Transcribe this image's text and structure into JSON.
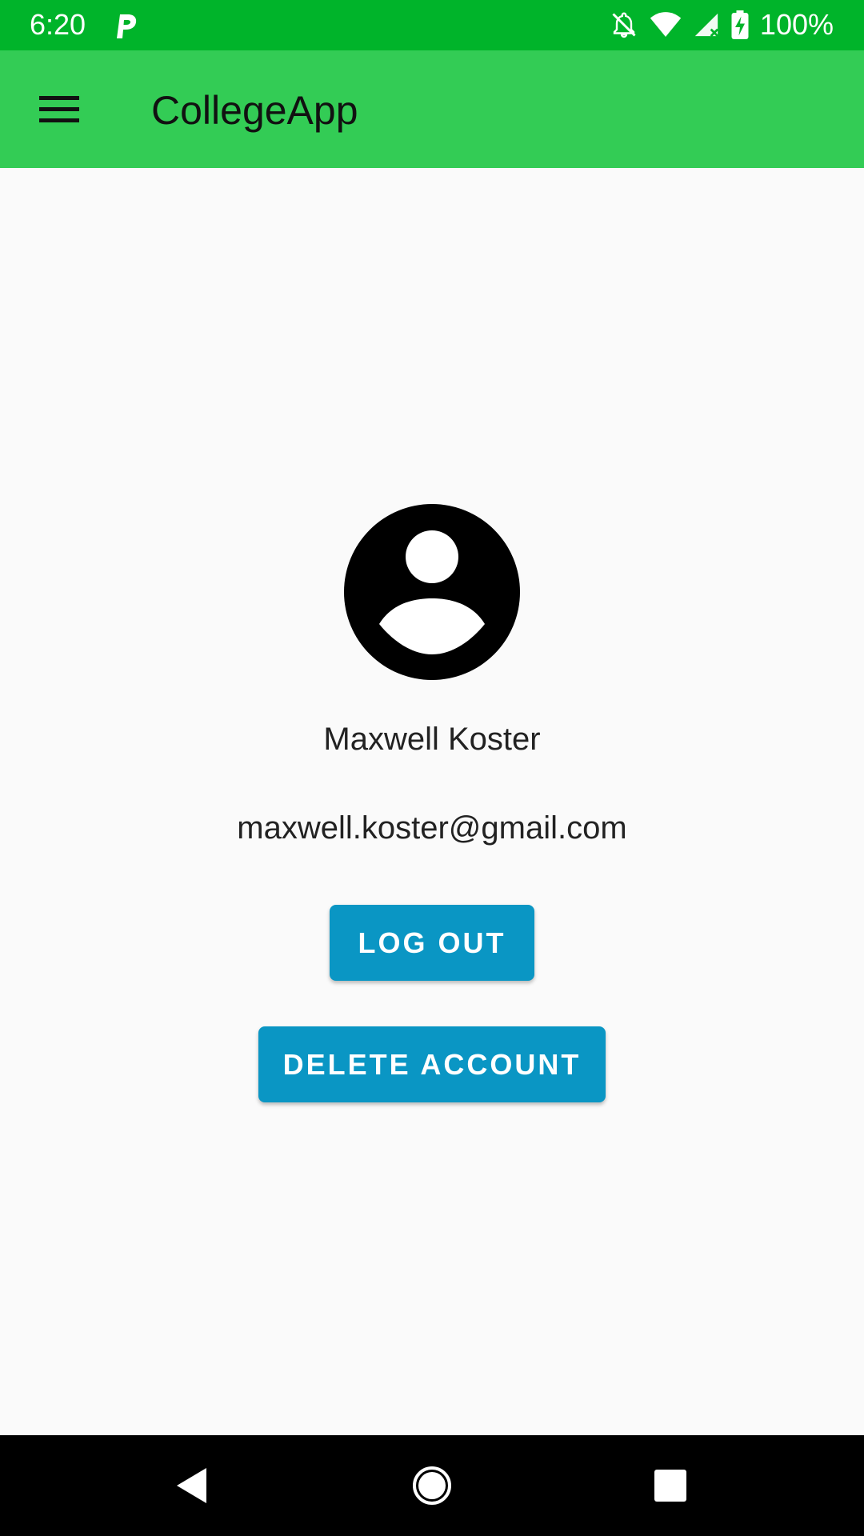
{
  "status_bar": {
    "time": "6:20",
    "battery": "100%",
    "icons": [
      "parking-app-icon",
      "notifications-off-icon",
      "wifi-icon",
      "signal-icon",
      "battery-charging-icon"
    ]
  },
  "app_bar": {
    "title": "CollegeApp",
    "menu_icon": "menu-icon"
  },
  "profile": {
    "avatar_icon": "account-circle-icon",
    "name": "Maxwell Koster",
    "email": "maxwell.koster@gmail.com"
  },
  "actions": {
    "logout_label": "LOG OUT",
    "delete_label": "DELETE ACCOUNT"
  },
  "nav_bar": {
    "icons": [
      "back-icon",
      "home-icon",
      "recents-icon"
    ]
  },
  "colors": {
    "status_bar": "#00b42a",
    "app_bar": "#33cc55",
    "button": "#0a96c4",
    "background": "#fafafa"
  }
}
